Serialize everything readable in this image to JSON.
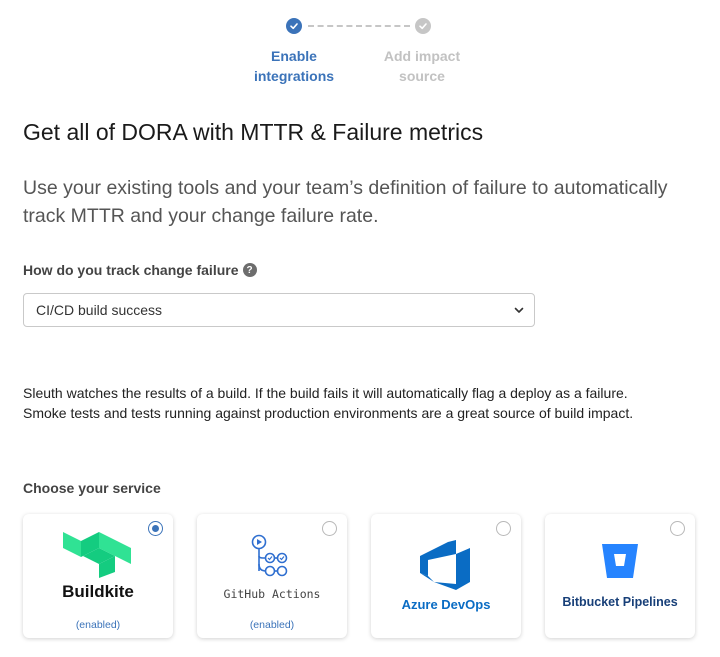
{
  "stepper": {
    "steps": [
      {
        "label": "Enable\nintegrations",
        "state": "complete"
      },
      {
        "label": "Add impact\nsource",
        "state": "pending"
      }
    ]
  },
  "title": "Get all of DORA with MTTR & Failure metrics",
  "subtitle": "Use your existing tools and your team’s definition of failure to automatically track MTTR and your change failure rate.",
  "failure_tracking": {
    "label": "How do you track change failure",
    "help_icon": "?",
    "selected": "CI/CD build success"
  },
  "description": {
    "line1": "Sleuth watches the results of a build. If the build fails it will automatically flag a deploy as a failure.",
    "line2": "Smoke tests and tests running against production environments are a great source of build impact."
  },
  "services": {
    "label": "Choose your service",
    "items": [
      {
        "name": "Buildkite",
        "status": "(enabled)",
        "selected": true,
        "icon": "buildkite-logo"
      },
      {
        "name": "GitHub Actions",
        "status": "(enabled)",
        "selected": false,
        "icon": "github-actions-logo"
      },
      {
        "name": "Azure DevOps",
        "status": "",
        "selected": false,
        "icon": "azure-devops-logo"
      },
      {
        "name": "Bitbucket Pipelines",
        "status": "",
        "selected": false,
        "icon": "bitbucket-logo"
      }
    ]
  },
  "colors": {
    "accent": "#3b73b9",
    "inactive": "#c6c6c6",
    "buildkite_green": "#30e294",
    "azure_blue": "#0a6cc4",
    "bitbucket_blue": "#2684ff"
  }
}
